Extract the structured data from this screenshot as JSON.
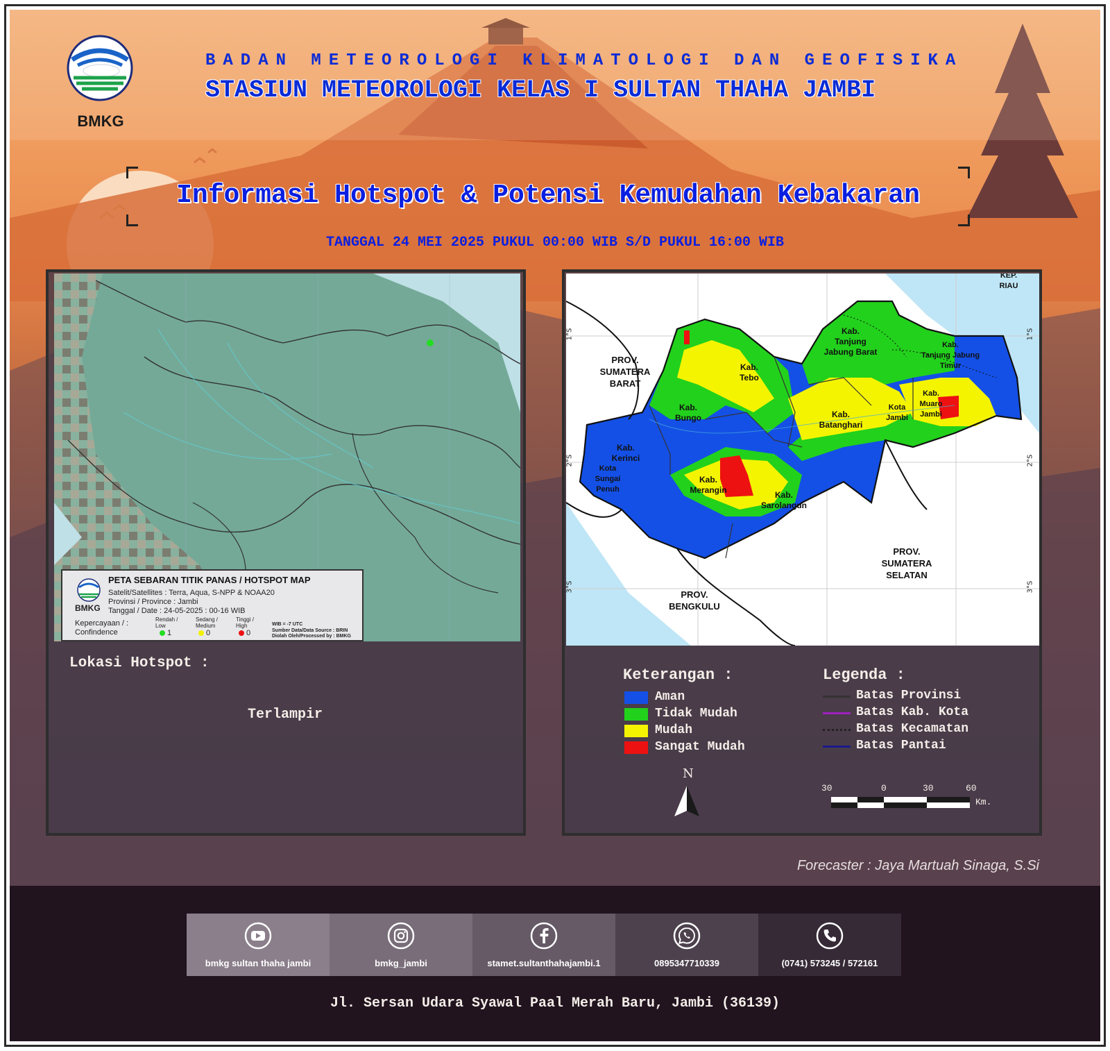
{
  "header": {
    "logo_text": "BMKG",
    "agency": "BADAN METEOROLOGI KLIMATOLOGI DAN GEOFISIKA",
    "station": "STASIUN METEOROLOGI KELAS I SULTAN THAHA JAMBI"
  },
  "title": "Informasi Hotspot & Potensi Kemudahan Kebakaran",
  "date_line": "TANGGAL 24 MEI 2025 PUKUL 00:00 WIB S/D PUKUL 16:00 WIB",
  "hotspot_map": {
    "inset_logo": "BMKG",
    "heading": "PETA SEBARAN TITIK PANAS / HOTSPOT MAP",
    "satellites": "Satelit/Satellites : Terra, Aqua, S-NPP & NOAA20",
    "province": "Provinsi / Province : Jambi",
    "date": "Tanggal / Date : 24-05-2025 : 00-16 WIB",
    "confidence_label": "Kepercayaan / :",
    "confidence_label2": "Confindence",
    "levels": [
      {
        "label": "Rendah /",
        "label2": "Low",
        "count": "1",
        "color": "#22dd22"
      },
      {
        "label": "Sedang /",
        "label2": "Medium",
        "count": "0",
        "color": "#f2f200"
      },
      {
        "label": "Tinggi /",
        "label2": "High",
        "count": "0",
        "color": "#ee1111"
      }
    ],
    "wib_note": "WIB = -7 UTC",
    "source": "Sumber Data/Data Source : BRIN",
    "processed": "Diolah Oleh/Processed by   : BMKG",
    "hotspots_detected": 1
  },
  "fire_map": {
    "regions": [
      {
        "name": "PROV. SUMATERA BARAT",
        "l1": "PROV.",
        "l2": "SUMATERA",
        "l3": "BARAT"
      },
      {
        "name": "PROV. BENGKULU",
        "l1": "PROV.",
        "l2": "BENGKULU"
      },
      {
        "name": "PROV. SUMATERA SELATAN",
        "l1": "PROV.",
        "l2": "SUMATERA",
        "l3": "SELATAN"
      },
      {
        "name": "KEP. RIAU",
        "l1": "KEP.",
        "l2": "RIAU"
      }
    ],
    "districts": [
      {
        "l1": "Kab.",
        "l2": "Tebo"
      },
      {
        "l1": "Kab.",
        "l2": "Bungo"
      },
      {
        "l1": "Kab.",
        "l2": "Kerinci"
      },
      {
        "l1": "Kota",
        "l2": "Sungai",
        "l3": "Penuh"
      },
      {
        "l1": "Kab.",
        "l2": "Merangin"
      },
      {
        "l1": "Kab.",
        "l2": "Sarolangun"
      },
      {
        "l1": "Kab.",
        "l2": "Batanghari"
      },
      {
        "l1": "Kab.",
        "l2": "Tanjung",
        "l3": "Jabung Barat"
      },
      {
        "l1": "Kab.",
        "l2": "Tanjung Jabung",
        "l3": "Timur"
      },
      {
        "l1": "Kab.",
        "l2": "Muaro",
        "l3": "Jambi"
      },
      {
        "l1": "Kota",
        "l2": "Jambi"
      }
    ],
    "lat_ticks": [
      "1°S",
      "2°S",
      "3°S"
    ]
  },
  "hotspot_location": {
    "label": "Lokasi Hotspot :",
    "value": "Terlampir"
  },
  "keterangan": {
    "title": "Keterangan :",
    "items": [
      {
        "label": "Aman",
        "color": "#1450e6"
      },
      {
        "label": "Tidak Mudah",
        "color": "#22d11c"
      },
      {
        "label": "Mudah",
        "color": "#f4f400"
      },
      {
        "label": "Sangat Mudah",
        "color": "#ee1111"
      }
    ]
  },
  "legenda": {
    "title": "Legenda :",
    "items": [
      {
        "label": "Batas Provinsi",
        "color": "#333333",
        "style": "solid"
      },
      {
        "label": "Batas Kab. Kota",
        "color": "#a020c0",
        "style": "solid"
      },
      {
        "label": "Batas Kecamatan",
        "color": "#222222",
        "style": "dotted"
      },
      {
        "label": "Batas Pantai",
        "color": "#1a1a8a",
        "style": "solid"
      }
    ],
    "north": "N",
    "scale": {
      "ticks": [
        "30",
        "0",
        "30",
        "60"
      ],
      "unit": "Km."
    }
  },
  "forecaster": "Forecaster : Jaya Martuah Sinaga, S.Si",
  "social": [
    {
      "icon": "youtube-icon",
      "text": "bmkg sultan thaha jambi",
      "bg": "#8a7f8a"
    },
    {
      "icon": "instagram-icon",
      "text": "bmkg_jambi",
      "bg": "#786d78"
    },
    {
      "icon": "facebook-icon",
      "text": "stamet.sultanthahajambi.1",
      "bg": "#655a65"
    },
    {
      "icon": "whatsapp-icon",
      "text": "0895347710339",
      "bg": "#4d414d"
    },
    {
      "icon": "phone-icon",
      "text": "(0741) 573245 / 572161",
      "bg": "#362a36"
    }
  ],
  "address": "Jl. Sersan Udara Syawal Paal Merah Baru, Jambi (36139)"
}
